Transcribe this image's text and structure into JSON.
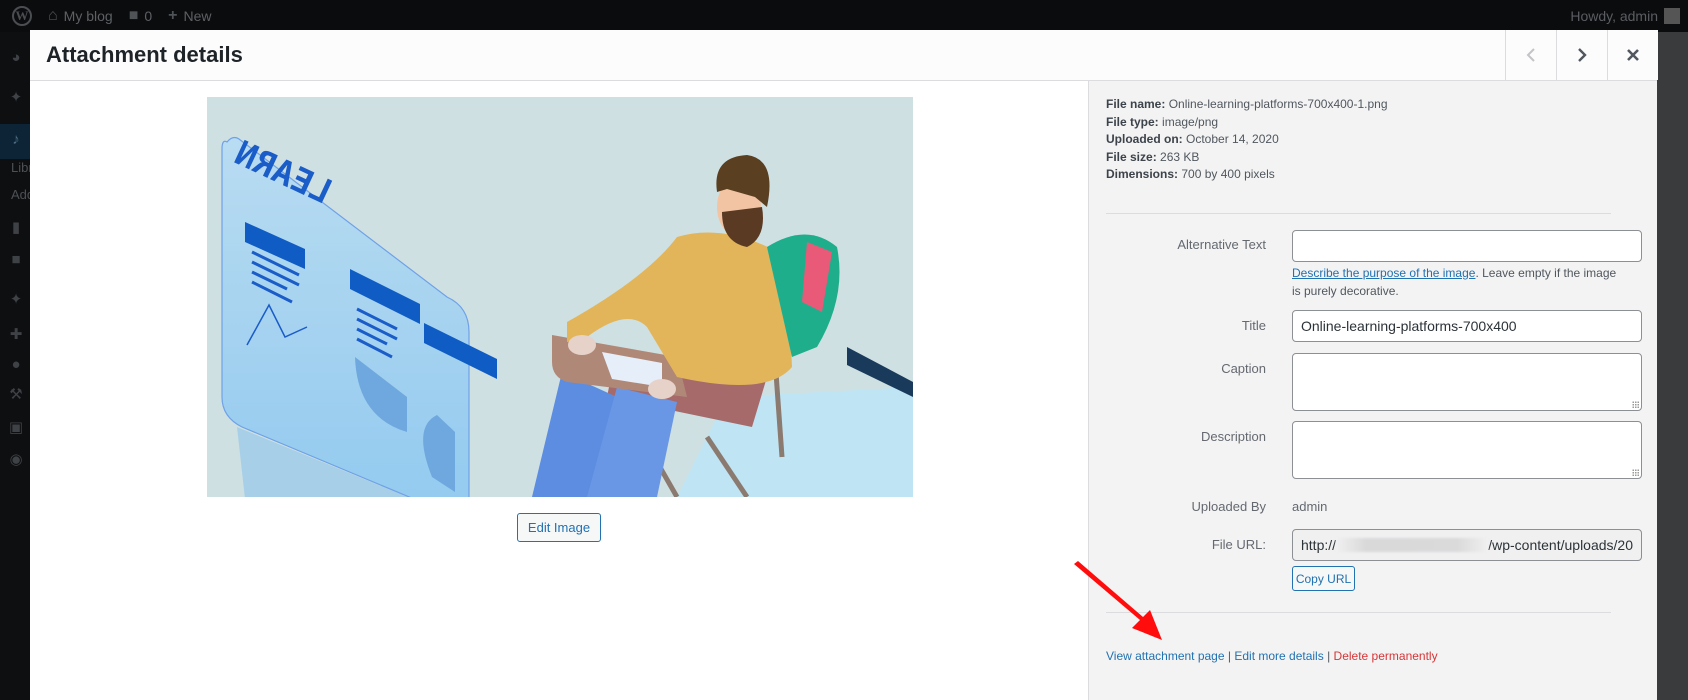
{
  "adminbar": {
    "site_name": "My blog",
    "comments_count": "0",
    "new_label": "New",
    "greeting": "Howdy, admin"
  },
  "adminmenu": {
    "submenu": [
      "Library",
      "Add New"
    ]
  },
  "modal": {
    "title": "Attachment details",
    "prev_label": "Previous",
    "next_label": "Next",
    "close_label": "Close"
  },
  "preview": {
    "alt": "Online learning illustration: man in chair with backpack facing a LEARN screen",
    "screen_text": "LEARN",
    "edit_button": "Edit Image"
  },
  "file_info": {
    "file_name_label": "File name:",
    "file_name": "Online-learning-platforms-700x400-1.png",
    "file_type_label": "File type:",
    "file_type": "image/png",
    "uploaded_on_label": "Uploaded on:",
    "uploaded_on": "October 14, 2020",
    "file_size_label": "File size:",
    "file_size": "263 KB",
    "dimensions_label": "Dimensions:",
    "dimensions": "700 by 400 pixels"
  },
  "fields": {
    "alt_text": {
      "label": "Alternative Text",
      "value": ""
    },
    "alt_help_link": "Describe the purpose of the image",
    "alt_help_rest": ". Leave empty if the image is purely decorative.",
    "title": {
      "label": "Title",
      "value": "Online-learning-platforms-700x400"
    },
    "caption": {
      "label": "Caption",
      "value": ""
    },
    "description": {
      "label": "Description",
      "value": ""
    },
    "uploaded_by": {
      "label": "Uploaded By",
      "value": "admin"
    },
    "file_url": {
      "label": "File URL:",
      "prefix": "http://",
      "suffix": "/wp-content/uploads/20"
    },
    "copy_url": "Copy URL"
  },
  "actions": {
    "view_attachment": "View attachment page",
    "edit_more": "Edit more details",
    "delete": "Delete permanently",
    "separator": "|"
  },
  "colors": {
    "link": "#2271b1",
    "delete": "#d63638",
    "annotation_arrow": "#ff0000"
  }
}
